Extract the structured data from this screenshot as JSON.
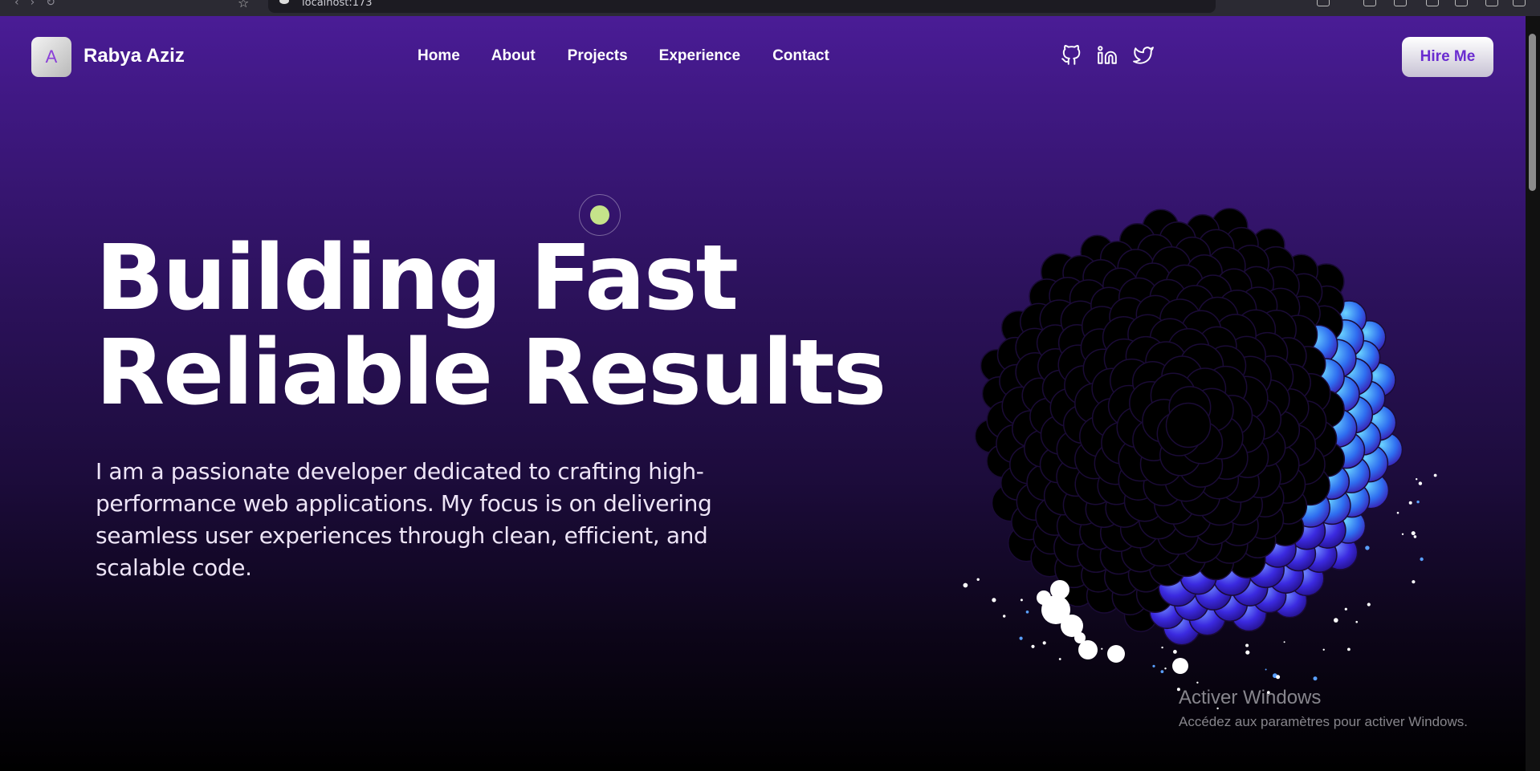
{
  "browser": {
    "url": "localhost:173"
  },
  "header": {
    "logo_letter": "A",
    "brand_name": "Rabya Aziz",
    "nav": [
      {
        "label": "Home"
      },
      {
        "label": "About"
      },
      {
        "label": "Projects"
      },
      {
        "label": "Experience"
      },
      {
        "label": "Contact"
      }
    ],
    "socials": [
      {
        "icon": "github-icon"
      },
      {
        "icon": "linkedin-icon"
      },
      {
        "icon": "twitter-icon"
      }
    ],
    "cta_label": "Hire Me"
  },
  "hero": {
    "title_line1": "Building Fast",
    "title_line2": "Reliable Results",
    "description": "I am a passionate developer dedicated to crafting high-performance web applications. My focus is on delivering seamless user experiences through clean, efficient, and scalable code."
  },
  "watermark": {
    "title": "Activer Windows",
    "subtitle": "Accédez aux paramètres pour activer Windows."
  },
  "colors": {
    "bg_top": "#4a1c96",
    "bg_bottom": "#000000",
    "accent_dot": "#c5e38a",
    "brand_purple": "#6a2cd0"
  }
}
